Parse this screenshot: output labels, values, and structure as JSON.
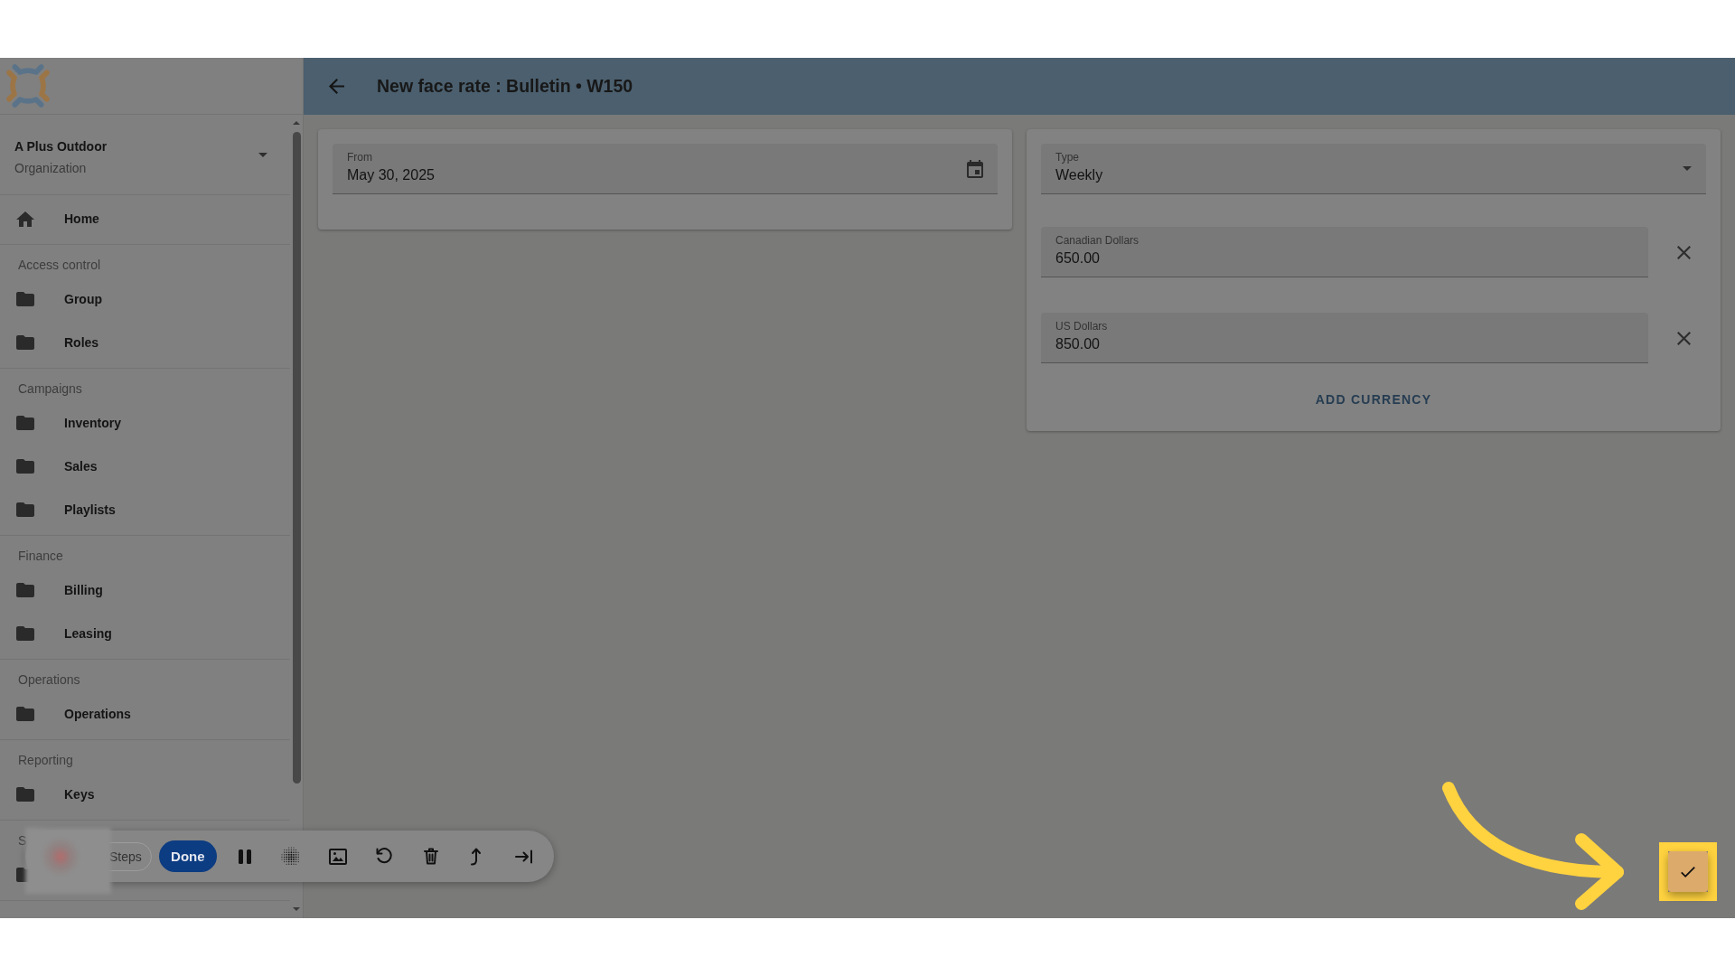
{
  "header": {
    "title": "New face rate : Bulletin • W150"
  },
  "sidebar": {
    "organization": {
      "name": "A Plus Outdoor",
      "caption": "Organization"
    },
    "groups": [
      {
        "items": [
          {
            "kind": "home",
            "label": "Home"
          }
        ]
      },
      {
        "heading": "Access control",
        "items": [
          {
            "kind": "folder",
            "label": "Group"
          },
          {
            "kind": "folder",
            "label": "Roles"
          }
        ]
      },
      {
        "heading": "Campaigns",
        "items": [
          {
            "kind": "folder",
            "label": "Inventory"
          },
          {
            "kind": "folder",
            "label": "Sales"
          },
          {
            "kind": "folder",
            "label": "Playlists"
          }
        ]
      },
      {
        "heading": "Finance",
        "items": [
          {
            "kind": "folder",
            "label": "Billing"
          },
          {
            "kind": "folder",
            "label": "Leasing"
          }
        ]
      },
      {
        "heading": "Operations",
        "items": [
          {
            "kind": "folder",
            "label": "Operations"
          }
        ]
      },
      {
        "heading": "Reporting",
        "items": [
          {
            "kind": "folder",
            "label": "Keys"
          }
        ]
      },
      {
        "heading": "S",
        "items": [
          {
            "kind": "folder"
          }
        ]
      }
    ]
  },
  "from_field": {
    "label": "From",
    "value": "May 30, 2025"
  },
  "rate_card": {
    "type_field": {
      "label": "Type",
      "value": "Weekly"
    },
    "currencies": [
      {
        "label": "Canadian Dollars",
        "value": "650.00"
      },
      {
        "label": "US Dollars",
        "value": "850.00"
      }
    ],
    "add_button": "ADD CURRENCY"
  },
  "confirm_button": {
    "highlighted": true
  },
  "recorder_toolbar": {
    "buttons": [
      {
        "label": "Steps",
        "primary": false
      },
      {
        "label": "Done",
        "primary": true
      }
    ]
  }
}
